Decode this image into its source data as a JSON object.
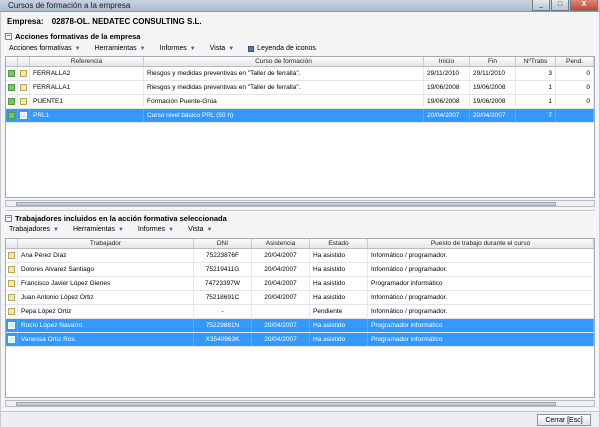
{
  "window": {
    "title": "Cursos de formación a la empresa",
    "minimize": "_",
    "maximize": "□",
    "close": "X"
  },
  "empresa": {
    "label": "Empresa:",
    "value": "02878-OL. NEDATEC CONSULTING S.L."
  },
  "acciones": {
    "title": "Acciones formativas de la empresa",
    "collapse": "−",
    "menu": [
      "Acciones formativas",
      "Herramientas",
      "Informes",
      "Vista"
    ],
    "legend": "Leyenda de iconos",
    "columns": [
      "Referencia",
      "Curso de formación",
      "Inicio",
      "Fin",
      "NºTrabs",
      "Pend."
    ],
    "rows": [
      {
        "ref": "FERRALLA2",
        "curso": "Riesgos y medidas preventivas en \"Taller de ferralla\".",
        "inicio": "29/11/2010",
        "fin": "29/11/2010",
        "trabs": "3",
        "pend": "0"
      },
      {
        "ref": "FERRALLA1",
        "curso": "Riesgos y medidas preventivas en \"Taller de ferralla\".",
        "inicio": "19/06/2008",
        "fin": "19/06/2008",
        "trabs": "1",
        "pend": "0"
      },
      {
        "ref": "PUENTE1",
        "curso": "Formación Puente-Grúa",
        "inicio": "19/06/2008",
        "fin": "19/06/2008",
        "trabs": "1",
        "pend": "0"
      },
      {
        "ref": "PRL1",
        "curso": "Curso nivel básico PRL (50 h)",
        "inicio": "20/04/2007",
        "fin": "20/04/2007",
        "trabs": "7",
        "pend": ""
      }
    ]
  },
  "trabajadores": {
    "title": "Trabajadores incluidos en la acción formativa seleccionada",
    "collapse": "−",
    "menu": [
      "Trabajadores",
      "Herramientas",
      "Informes",
      "Vista"
    ],
    "columns": [
      "Trabajador",
      "DNI",
      "Asistencia",
      "Estado",
      "Puesto de trabajo durante el curso"
    ],
    "rows": [
      {
        "nombre": "Ana Pérez Díaz",
        "dni": "75223876F",
        "asistencia": "20/04/2007",
        "estado": "Ha asistido",
        "puesto": "Informático / programador."
      },
      {
        "nombre": "Dolores Alvarez Santiago",
        "dni": "75219411G",
        "asistencia": "20/04/2007",
        "estado": "Ha asistido",
        "puesto": "Informático / programador."
      },
      {
        "nombre": "Francisco Javier López Gienes",
        "dni": "74723397W",
        "asistencia": "20/04/2007",
        "estado": "Ha asistido",
        "puesto": "Programador informático"
      },
      {
        "nombre": "Juan Antonio López Ortiz",
        "dni": "75218691C",
        "asistencia": "20/04/2007",
        "estado": "Ha asistido",
        "puesto": "Informático / programador."
      },
      {
        "nombre": "Pepa López Ortiz",
        "dni": "-",
        "asistencia": "",
        "estado": "Pendiente",
        "puesto": "Informático / programador."
      },
      {
        "nombre": "Rocío López Navarro",
        "dni": "75223881N",
        "asistencia": "20/04/2007",
        "estado": "Ha asistido",
        "puesto": "Programador informático"
      },
      {
        "nombre": "Vanessa Ortiz Ros",
        "dni": "X3540963K",
        "asistencia": "20/04/2007",
        "estado": "Ha asistido",
        "puesto": "Programador informático"
      }
    ]
  },
  "footer": {
    "close_label": "Cerrar  [Esc]"
  },
  "colors": {
    "selection": "#3399ff"
  }
}
